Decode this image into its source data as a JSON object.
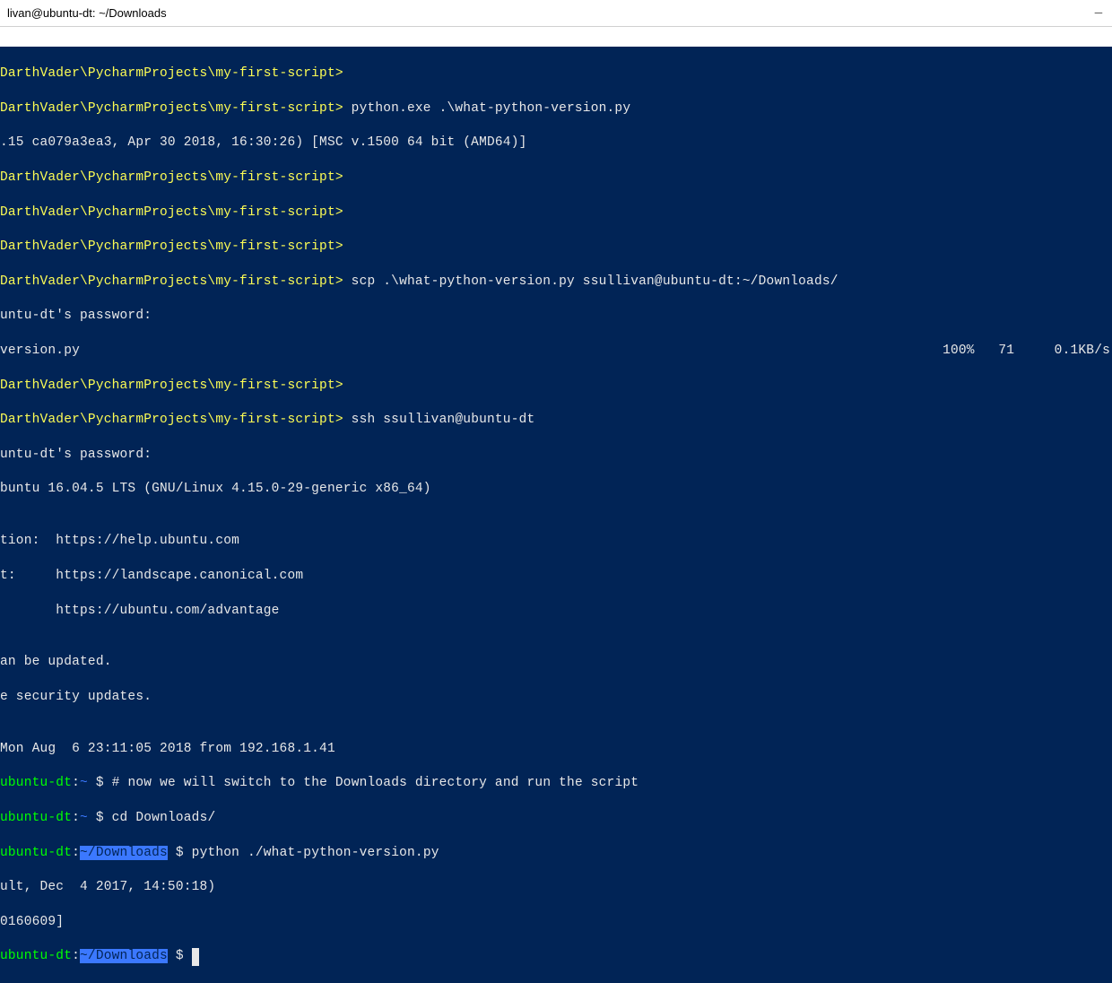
{
  "titlebar": {
    "title": "livan@ubuntu-dt: ~/Downloads"
  },
  "lines": {
    "l1_path": "DarthVader\\PycharmProjects\\my-first-script>",
    "l2_path": "DarthVader\\PycharmProjects\\my-first-script>",
    "l2_cmd": " python.exe .\\what-python-version.py",
    "l3": ".15 ca079a3ea3, Apr 30 2018, 16:30:26) [MSC v.1500 64 bit (AMD64)]",
    "l4_path": "DarthVader\\PycharmProjects\\my-first-script>",
    "l5_path": "DarthVader\\PycharmProjects\\my-first-script>",
    "l6_path": "DarthVader\\PycharmProjects\\my-first-script>",
    "l7_path": "DarthVader\\PycharmProjects\\my-first-script>",
    "l7_cmd": " scp .\\what-python-version.py ssullivan@ubuntu-dt:~/Downloads/",
    "l8": "untu-dt's password:",
    "l9_left": "version.py",
    "l9_right": "100%   71     0.1KB/s",
    "l10_path": "DarthVader\\PycharmProjects\\my-first-script>",
    "l11_path": "DarthVader\\PycharmProjects\\my-first-script>",
    "l11_cmd": " ssh ssullivan@ubuntu-dt",
    "l12": "untu-dt's password:",
    "l13": "buntu 16.04.5 LTS (GNU/Linux 4.15.0-29-generic x86_64)",
    "blank1": "",
    "l14": "tion:  https://help.ubuntu.com",
    "l15": "t:     https://landscape.canonical.com",
    "l16": "       https://ubuntu.com/advantage",
    "blank2": "",
    "l17": "an be updated.",
    "l18": "e security updates.",
    "blank3": "",
    "l19": "Mon Aug  6 23:11:05 2018 from 192.168.1.41",
    "l20_host": "ubuntu-dt",
    "l20_tilde": "~",
    "l20_dollar": " $ ",
    "l20_cmd": "# now we will switch to the Downloads directory and run the script",
    "l21_host": "ubuntu-dt",
    "l21_tilde": "~",
    "l21_dollar": " $ ",
    "l21_cmd": "cd Downloads/",
    "l22_host": "ubuntu-dt",
    "l22_path": "~/Downloads",
    "l22_dollar": " $ ",
    "l22_cmd": "python ./what-python-version.py",
    "l23": "ult, Dec  4 2017, 14:50:18)",
    "l24": "0160609]",
    "l25_host": "ubuntu-dt",
    "l25_path": "~/Downloads",
    "l25_dollar": " $ "
  }
}
